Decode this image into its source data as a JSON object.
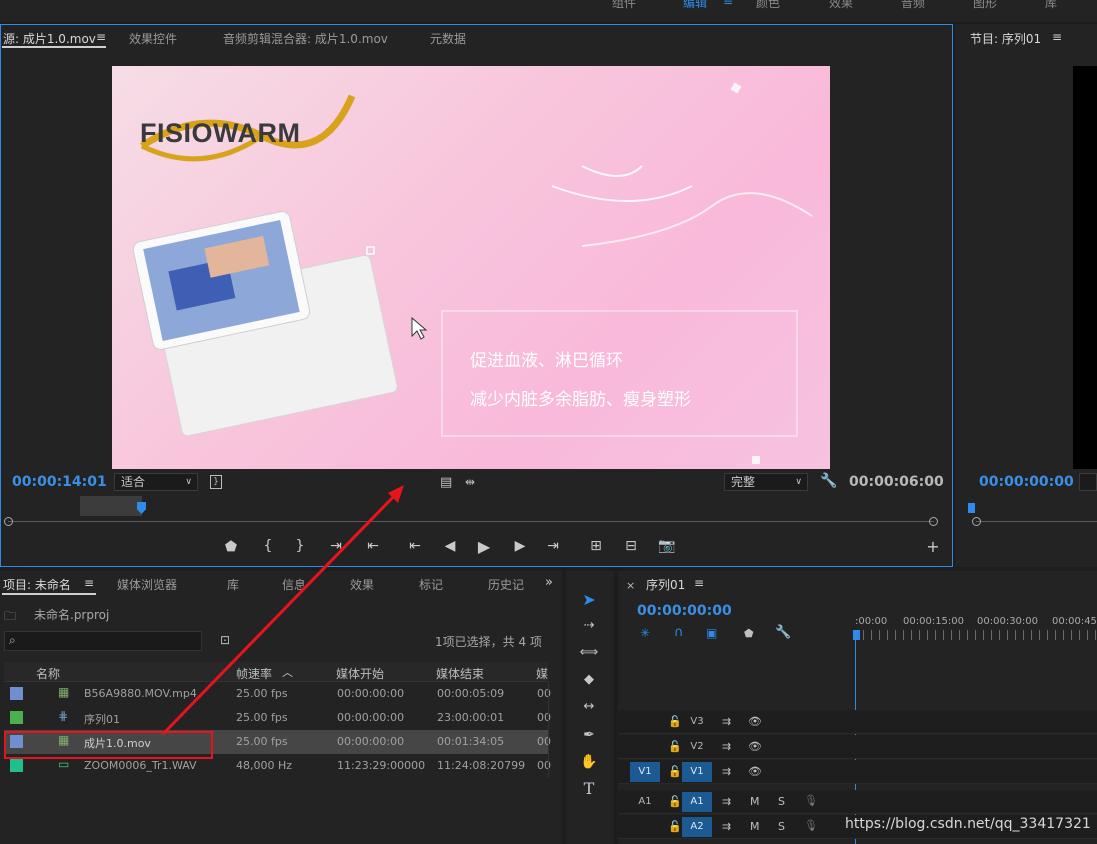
{
  "workspace_tabs": [
    "组件",
    "编辑",
    "颜色",
    "效果",
    "音频",
    "图形",
    "库"
  ],
  "source": {
    "tabs": [
      "源: 成片1.0.mov",
      "效果控件",
      "音频剪辑混合器: 成片1.0.mov",
      "元数据"
    ],
    "timecode": "00:00:14:01",
    "fit": "适合",
    "quality": "完整",
    "duration": "00:00:06:00",
    "video": {
      "logo": "FISIOWARM",
      "line1": "促进血液、淋巴循环",
      "line2": "减少内脏多余脂肪、瘦身塑形"
    }
  },
  "program": {
    "title": "节目: 序列01",
    "timecode": "00:00:00:00"
  },
  "project": {
    "tabs": [
      "项目: 未命名",
      "媒体浏览器",
      "库",
      "信息",
      "效果",
      "标记",
      "历史记"
    ],
    "file": "未命名.prproj",
    "selection": "1项已选择，共 4 项",
    "columns": [
      "名称",
      "帧速率",
      "媒体开始",
      "媒体结束",
      "媒"
    ],
    "rows": [
      {
        "name": "B56A9880.MOV.mp4",
        "rate": "25.00 fps",
        "start": "00:00:00:00",
        "end": "00:00:05:09",
        "extra": "00",
        "color": "#6f8fd0",
        "icon": "video-clip-icon"
      },
      {
        "name": "序列01",
        "rate": "25.00 fps",
        "start": "00:00:00:00",
        "end": "23:00:00:01",
        "extra": "00",
        "color": "#4caf50",
        "icon": "sequence-icon"
      },
      {
        "name": "成片1.0.mov",
        "rate": "25.00 fps",
        "start": "00:00:00:00",
        "end": "00:01:34:05",
        "extra": "00",
        "color": "#6f8fd0",
        "icon": "video-clip-icon"
      },
      {
        "name": "ZOOM0006_Tr1.WAV",
        "rate": "48,000 Hz",
        "start": "11:23:29:00000",
        "end": "11:24:08:20799",
        "extra": "00",
        "color": "#1fbf8f",
        "icon": "audio-clip-icon"
      }
    ]
  },
  "timeline": {
    "title": "序列01",
    "timecode": "00:00:00:00",
    "ruler": [
      ":00:00",
      "00:00:15:00",
      "00:00:30:00",
      "00:00:45:"
    ],
    "tracks": [
      {
        "target": "",
        "label": "V3",
        "kind": "video"
      },
      {
        "target": "",
        "label": "V2",
        "kind": "video"
      },
      {
        "target": "V1",
        "label": "V1",
        "kind": "video"
      },
      {
        "target": "A1",
        "label": "A1",
        "kind": "audio"
      },
      {
        "target": "",
        "label": "A2",
        "kind": "audio"
      }
    ],
    "audio_buttons": [
      "M",
      "S"
    ]
  },
  "watermark": "https://blog.csdn.net/qq_33417321",
  "colors": {
    "accent": "#2d8ceb",
    "timecode": "#3b8fe6",
    "annotation": "#e8141b"
  }
}
